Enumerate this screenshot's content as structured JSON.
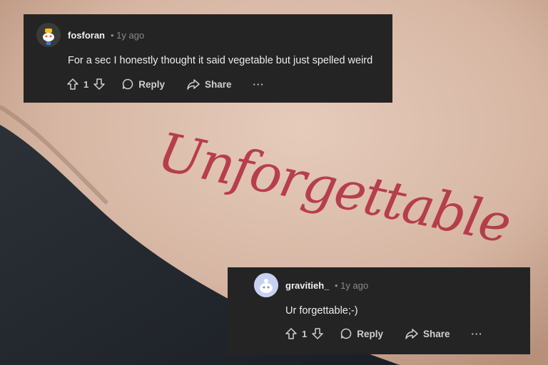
{
  "comments": [
    {
      "author": "fosforan",
      "time": "1y ago",
      "body": "For a sec I honestly thought it said vegetable but just spelled weird",
      "votes": "1",
      "reply_label": "Reply",
      "share_label": "Share",
      "more_label": "···"
    },
    {
      "author": "gravitieh_",
      "time": "1y ago",
      "body": "Ur forgettable;-)",
      "votes": "1",
      "reply_label": "Reply",
      "share_label": "Share",
      "more_label": "···"
    }
  ],
  "tattoo": {
    "text": "Unforgettable",
    "color": "#b0283c"
  },
  "colors": {
    "card_bg": "#242424",
    "text": "#e8e8e8",
    "muted": "#8a8a8a"
  },
  "icons": [
    "upvote-icon",
    "downvote-icon",
    "reply-bubble-icon",
    "share-arrow-icon",
    "more-dots-icon"
  ]
}
